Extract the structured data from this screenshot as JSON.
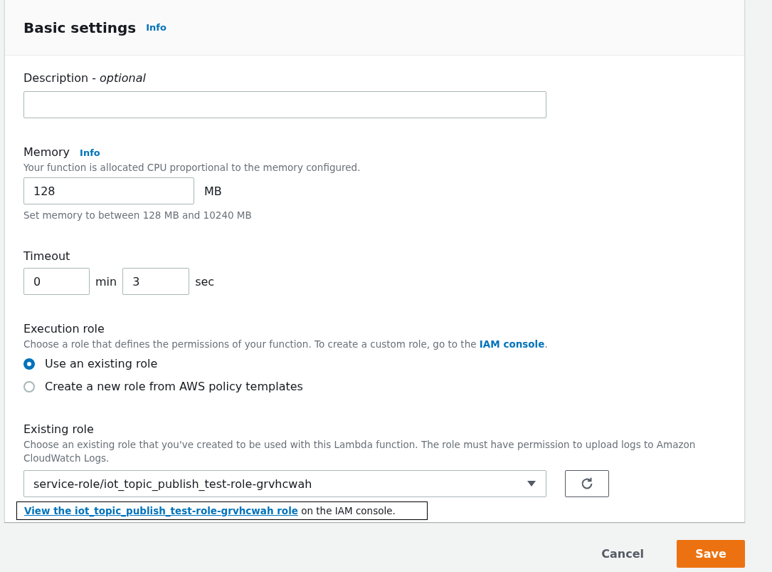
{
  "header": {
    "title": "Basic settings",
    "info": "Info"
  },
  "description": {
    "label": "Description - *optional*"
  },
  "memory": {
    "label": "Memory",
    "info": "Info",
    "hint": "Your function is allocated CPU proportional to the memory configured.",
    "value": "128",
    "unit": "MB",
    "constraint": "Set memory to between 128 MB and 10240 MB"
  },
  "timeout": {
    "label": "Timeout",
    "minutes": "0",
    "minutes_unit": "min",
    "seconds": "3",
    "seconds_unit": "sec"
  },
  "execution_role": {
    "label": "Execution role",
    "hint": "Choose a role that defines the permissions of your function. To create a custom role, go to the",
    "hint_link": "IAM console",
    "hint_end": ".",
    "options": [
      {
        "label": "Use an existing role",
        "selected": true
      },
      {
        "label": "Create a new role from AWS policy templates",
        "selected": false
      }
    ]
  },
  "existing_role": {
    "label": "Existing role",
    "hint": "Choose an existing role that you've created to be used with this Lambda function. The role must have permission to upload logs to Amazon CloudWatch Logs.",
    "value": "service-role/iot_topic_publish_test-role-grvhcwah",
    "link": "View the iot_topic_publish_test-role-grvhcwah role",
    "link_suffix": "on the IAM console."
  },
  "buttons": {
    "cancel": "Cancel",
    "save": "Save"
  }
}
